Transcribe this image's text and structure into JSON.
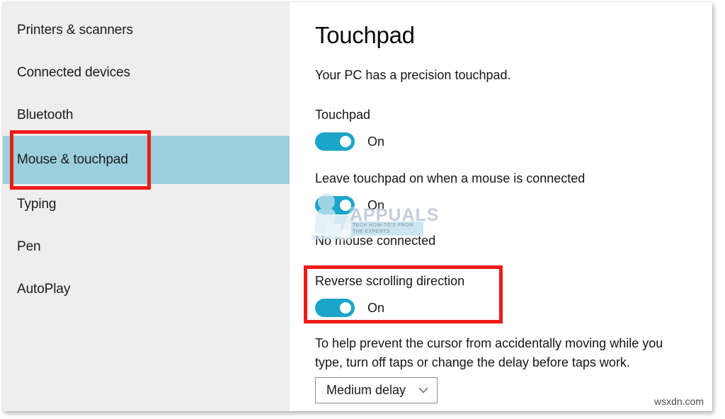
{
  "sidebar": {
    "items": [
      {
        "label": "Printers & scanners",
        "selected": false
      },
      {
        "label": "Connected devices",
        "selected": false
      },
      {
        "label": "Bluetooth",
        "selected": false
      },
      {
        "label": "Mouse & touchpad",
        "selected": true
      },
      {
        "label": "Typing",
        "selected": false
      },
      {
        "label": "Pen",
        "selected": false
      },
      {
        "label": "AutoPlay",
        "selected": false
      }
    ],
    "selected_item": "Mouse & touchpad",
    "highlight_color": "#9bcfdd"
  },
  "main": {
    "title": "Touchpad",
    "precision_note": "Your PC has a precision touchpad.",
    "settings": [
      {
        "label": "Touchpad",
        "toggle_state": "On",
        "toggle_on": true
      },
      {
        "label": "Leave touchpad on when a mouse is connected",
        "toggle_state": "On",
        "toggle_on": true
      },
      {
        "label": "Reverse scrolling direction",
        "toggle_state": "On",
        "toggle_on": true
      }
    ],
    "no_mouse_text": "No mouse connected",
    "delay_help": "To help prevent the cursor from accidentally moving while you type, turn off taps or change the delay before taps work.",
    "delay_dropdown": {
      "value": "Medium delay",
      "chevron": "chevron-down-icon"
    }
  },
  "annotations": {
    "box_color": "#ee1b16",
    "boxes": [
      {
        "target": "Mouse & touchpad"
      },
      {
        "target": "Reverse scrolling direction"
      }
    ]
  },
  "watermarks": {
    "appuals": {
      "word": "APPUALS",
      "tagline": "TECH HOW-TO'S FROM THE EXPERTS"
    },
    "site": "wsxdn.com"
  },
  "colors": {
    "toggle_on": "#1ba5c8",
    "sidebar_bg": "#eeeeee",
    "content_bg": "#ffffff",
    "annotation_red": "#ee1b16"
  }
}
